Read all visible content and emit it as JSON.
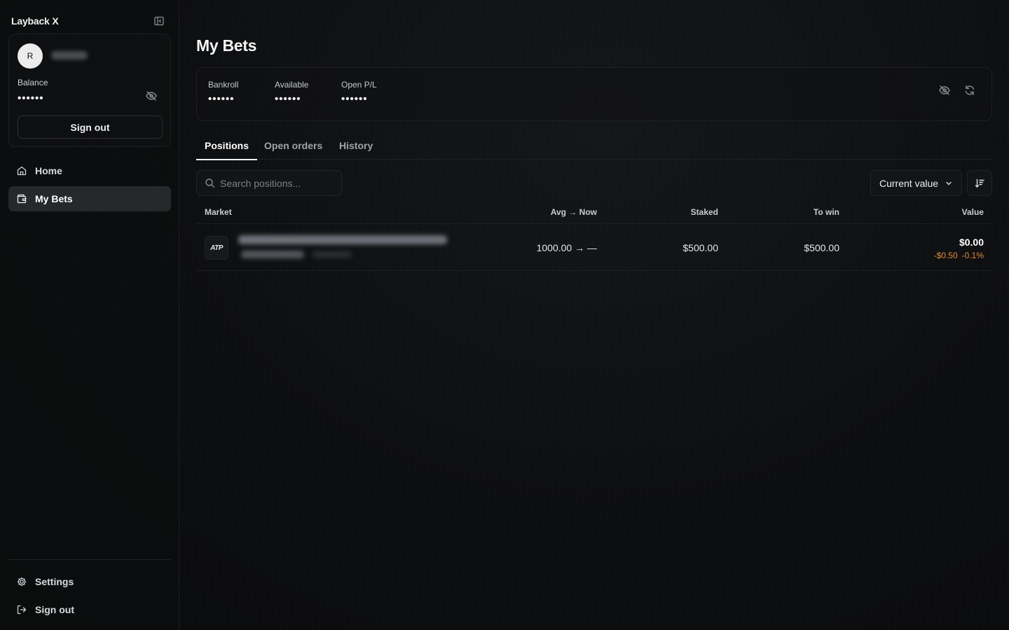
{
  "app": {
    "title": "Layback X"
  },
  "account": {
    "avatar_initial": "R",
    "balance_label": "Balance",
    "balance_value": "••••••",
    "signout_label": "Sign out"
  },
  "nav": {
    "items": [
      {
        "label": "Home",
        "icon": "home-icon",
        "active": false
      },
      {
        "label": "My Bets",
        "icon": "wallet-icon",
        "active": true
      }
    ],
    "bottom": [
      {
        "label": "Settings",
        "icon": "gear-icon"
      },
      {
        "label": "Sign out",
        "icon": "logout-icon"
      }
    ]
  },
  "page": {
    "title": "My Bets"
  },
  "stats": [
    {
      "label": "Bankroll",
      "value": "••••••"
    },
    {
      "label": "Available",
      "value": "••••••"
    },
    {
      "label": "Open P/L",
      "value": "••••••"
    }
  ],
  "tabs": [
    {
      "label": "Positions",
      "active": true
    },
    {
      "label": "Open orders",
      "active": false
    },
    {
      "label": "History",
      "active": false
    }
  ],
  "search": {
    "placeholder": "Search positions..."
  },
  "sort": {
    "selected": "Current value"
  },
  "table": {
    "columns": [
      "Market",
      "Avg → Now",
      "Staked",
      "To win",
      "Value"
    ],
    "rows": [
      {
        "logo_text": "ATP",
        "avg_now": "1000.00 → —",
        "staked": "$500.00",
        "to_win": "$500.00",
        "value": "$0.00",
        "pl_amount": "-$0.50",
        "pl_percent": "-0.1%"
      }
    ]
  },
  "colors": {
    "background": "#0c0d0e",
    "active_nav": "#26282b",
    "loss": "#e0893a"
  }
}
